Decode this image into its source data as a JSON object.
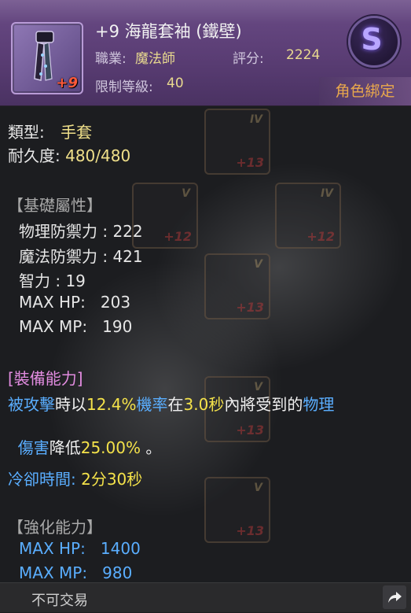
{
  "header": {
    "item_name": "+9 海龍套袖 (鐵壁)",
    "job_label": "職業:",
    "job_value": "魔法師",
    "score_label": "評分:",
    "score_value": "2224",
    "level_label": "限制等級:",
    "level_value": "40",
    "enhance_badge": "+9",
    "grade_letter": "S",
    "bind_label": "角色綁定"
  },
  "info": {
    "type_label": "類型:",
    "type_value": "手套",
    "durability_label": "耐久度:",
    "durability_value": "480/480"
  },
  "base_stats": {
    "title": "【基礎屬性】",
    "rows": [
      "物理防禦力 : 222",
      "魔法防禦力 : 421",
      "智力 : 19",
      "MAX HP:   203",
      "MAX MP:   190"
    ]
  },
  "equip_ability": {
    "title": "[裝備能力]",
    "seg1": "被攻擊",
    "seg2": "時以",
    "seg3": "12.4%",
    "seg4": "機率",
    "seg5": "在",
    "seg6": "3.0秒",
    "seg7": "內將受到的",
    "seg8": "物理",
    "seg9": "傷害",
    "seg10": "降低",
    "seg11": "25.00%",
    "seg12": " 。",
    "cooldown_label": "冷卻時間:",
    "cooldown_value": "2分30秒"
  },
  "enhance_ability": {
    "title": "【強化能力】",
    "rows": [
      "MAX HP:   1400",
      "MAX MP:   980"
    ]
  },
  "background_slots": [
    {
      "roman": "IV",
      "num": "+13"
    },
    {
      "roman": "V",
      "num": "+12"
    },
    {
      "roman": "IV",
      "num": "+12"
    },
    {
      "roman": "V",
      "num": "+13"
    },
    {
      "roman": "V",
      "num": "+13"
    },
    {
      "roman": "V",
      "num": "+13"
    }
  ],
  "footer": {
    "trade_status": "不可交易",
    "share_icon": "share-arrow-icon"
  },
  "colors": {
    "header_bg": "#5a3d74",
    "value_yellow": "#f0e08a",
    "highlight_blue": "#5aaeff",
    "highlight_yellow": "#f4e24a",
    "section_pink": "#e28ce0",
    "bind_orange": "#e9a84c"
  }
}
